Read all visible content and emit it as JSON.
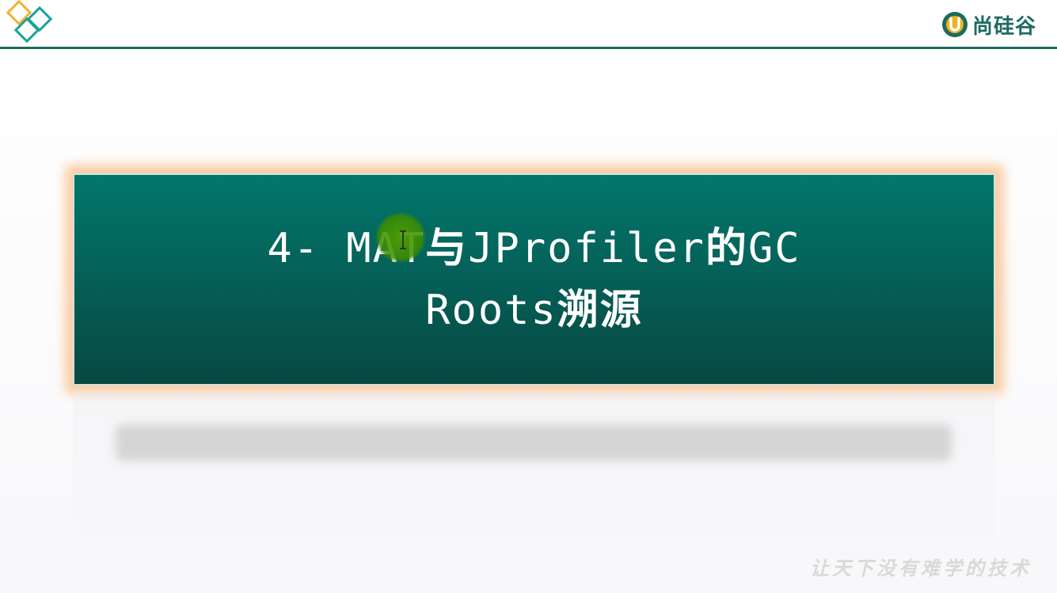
{
  "brand": {
    "name": "尚硅谷",
    "color": "#1d6b60",
    "slogan": "让天下没有难学的技术"
  },
  "slide": {
    "title_line1_prefix": "4- MAT",
    "title_line1_joiner": "与",
    "title_line1_mid": "JProfiler",
    "title_line1_de": "的",
    "title_line1_suffix": "GC",
    "title_line2_prefix": "Roots",
    "title_line2_suffix": "溯源",
    "box_color": "#02776c",
    "glow_color": "#fbc79a"
  },
  "icons": {
    "corner": "diamond-cluster-icon",
    "brand": "u-logo-icon",
    "cursor": "text-cursor-icon"
  }
}
